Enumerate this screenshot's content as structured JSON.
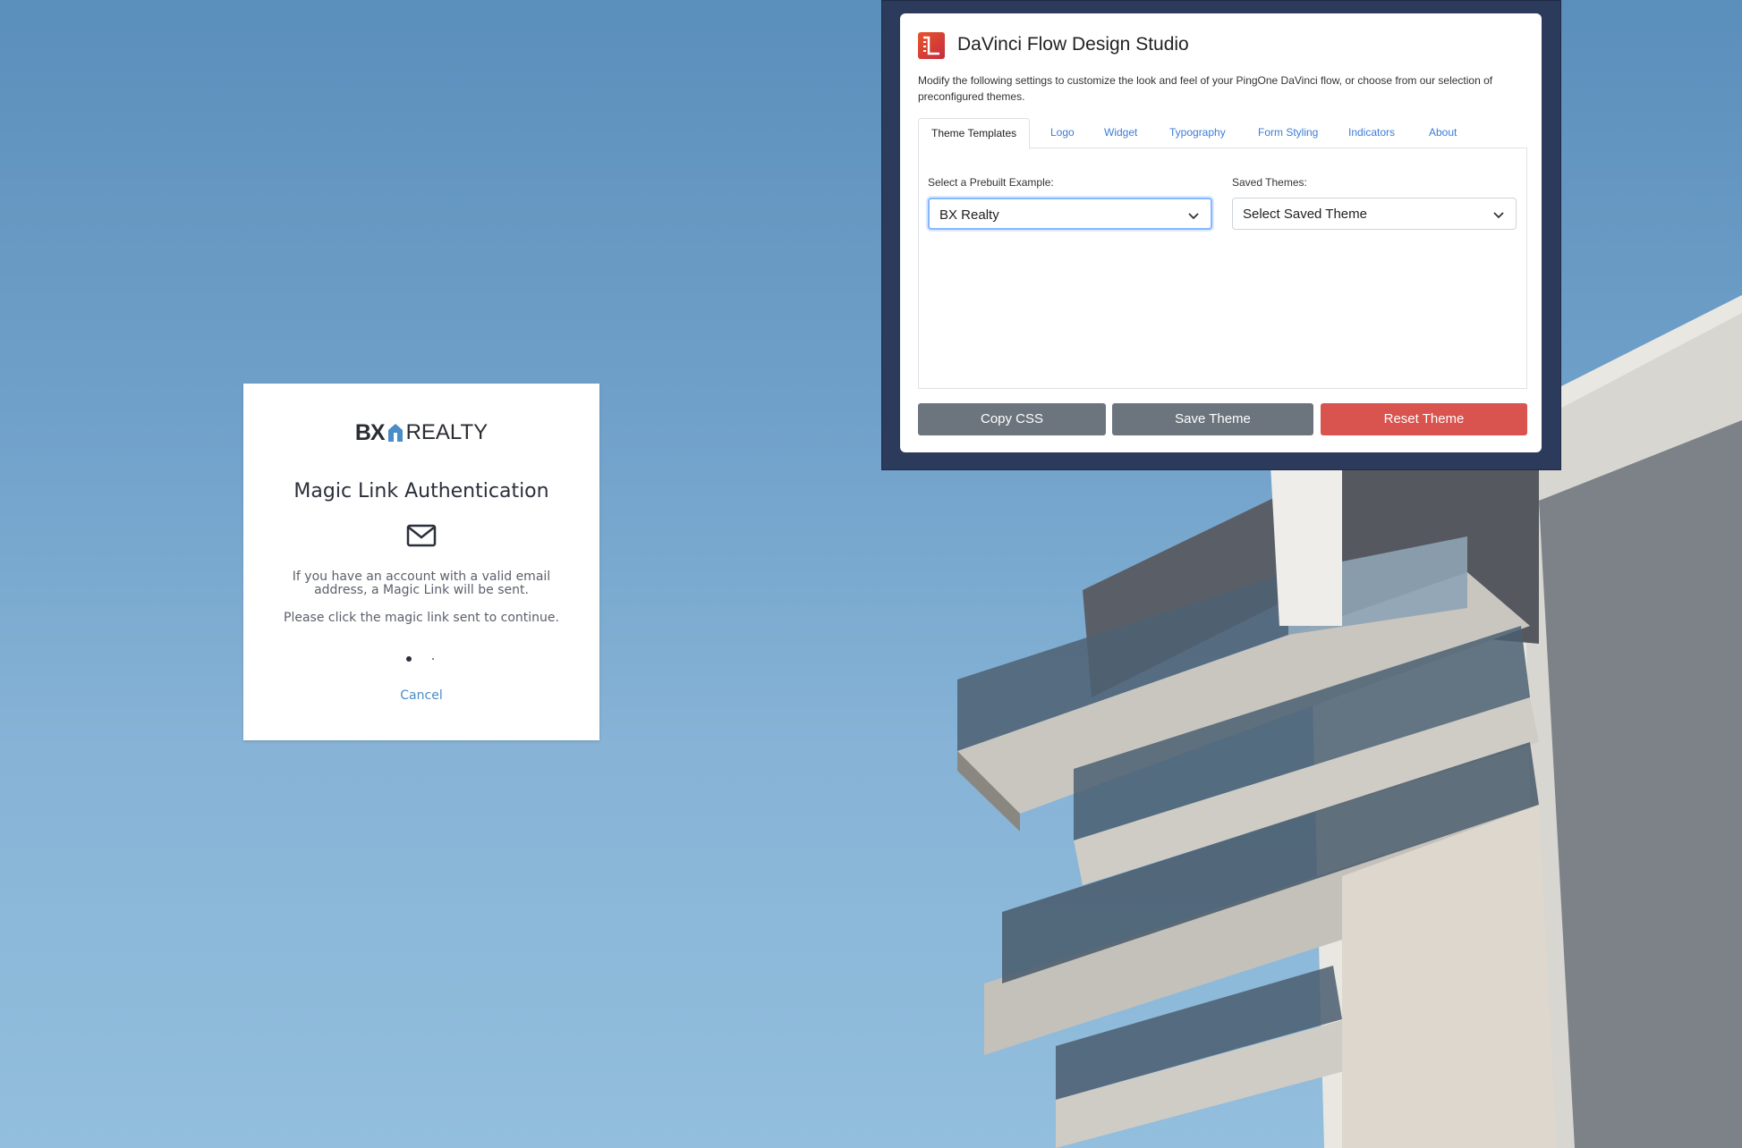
{
  "login": {
    "brand_bx": "BX",
    "brand_realty": "REALTY",
    "title": "Magic Link Authentication",
    "message": "If you have an account with a valid email address, a Magic Link will be sent.",
    "instruction": "Please click the magic link sent to continue.",
    "cancel_label": "Cancel"
  },
  "studio": {
    "title": "DaVinci Flow Design Studio",
    "description": "Modify the following settings to customize the look and feel of your PingOne DaVinci flow, or choose from our selection of preconfigured themes.",
    "tabs": [
      {
        "label": "Theme Templates",
        "active": true
      },
      {
        "label": "Logo"
      },
      {
        "label": "Widget"
      },
      {
        "label": "Typography"
      },
      {
        "label": "Form Styling"
      },
      {
        "label": "Indicators"
      },
      {
        "label": "About"
      }
    ],
    "prebuilt": {
      "label": "Select a Prebuilt Example:",
      "value": "BX Realty"
    },
    "saved": {
      "label": "Saved Themes:",
      "value": "Select Saved Theme"
    },
    "buttons": {
      "copy_css": "Copy CSS",
      "save_theme": "Save Theme",
      "reset_theme": "Reset Theme"
    }
  },
  "colors": {
    "brand_blue": "#4a8cc7",
    "panel_frame": "#2c3a5c",
    "reset_red": "#d9534f",
    "button_gray": "#6c757d"
  },
  "icons": {
    "envelope": "mail-icon",
    "dropdown": "chevron-down-icon",
    "studio_logo": "davinci-logo-icon"
  }
}
